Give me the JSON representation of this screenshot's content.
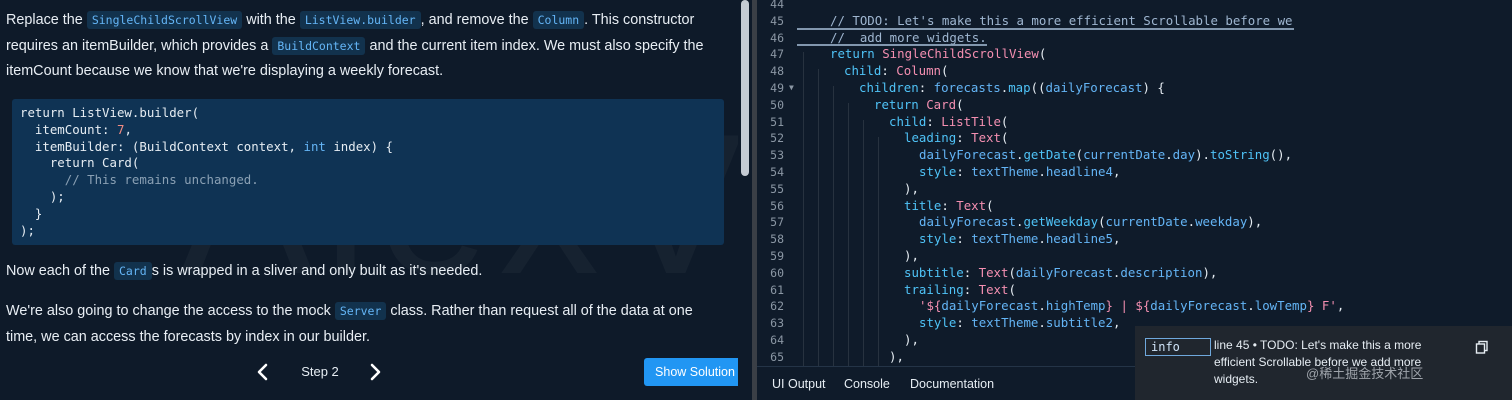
{
  "instructions": {
    "p1": {
      "a": "Replace the ",
      "code1": "SingleChildScrollView",
      "b": " with the ",
      "code2": "ListView.builder",
      "c": ", and remove the ",
      "code3": "Column",
      "d": ". This constructor requires an itemBuilder, which provides a ",
      "code4": "BuildContext",
      "e": " and the current item index. We must also specify the itemCount because we know that we're displaying a weekly forecast."
    },
    "snippet": {
      "l1a": "return ListView.builder(",
      "l2a": "  itemCount: ",
      "l2num": "7",
      "l2b": ",",
      "l3a": "  itemBuilder: (BuildContext context, ",
      "l3kw": "int",
      "l3b": " index) {",
      "l4a": "    return Card(",
      "l5cm": "      // This remains unchanged.",
      "l6a": "    );",
      "l7a": "  }",
      "l8a": ");"
    },
    "p2": {
      "a": "Now each of the ",
      "code": "Card",
      "b": "s is wrapped in a sliver and only built as it's needed."
    },
    "p3": {
      "a": "We're also going to change the access to the mock ",
      "code": "Server",
      "b": " class. Rather than request all of the data at one time, we can access the forecasts by index in our builder."
    },
    "watermark": "AlexV525"
  },
  "stepper": {
    "label": "Step 2",
    "show_solution": "Show Solution",
    "prev_icon": "chevron-left-icon",
    "next_icon": "chevron-right-icon"
  },
  "editor": {
    "line_numbers": [
      "44",
      "45",
      "46",
      "47",
      "48",
      "49",
      "50",
      "51",
      "52",
      "53",
      "54",
      "55",
      "56",
      "57",
      "58",
      "59",
      "60",
      "61",
      "62",
      "63",
      "64",
      "65"
    ],
    "lines": {
      "l45": "// TODO: Let's make this a more efficient Scrollable before we",
      "l46": "//  add more widgets.",
      "l47a": "return ",
      "l47b": "SingleChildScrollView",
      "l47c": "(",
      "l48a": "child",
      "l48b": ": ",
      "l48c": "Column",
      "l48d": "(",
      "l49a": "children",
      "l49b": ": ",
      "l49c": "forecasts",
      "l49d": ".",
      "l49e": "map",
      "l49f": "((",
      "l49g": "dailyForecast",
      "l49h": ") {",
      "l50a": "return ",
      "l50b": "Card",
      "l50c": "(",
      "l51a": "child",
      "l51b": ": ",
      "l51c": "ListTile",
      "l51d": "(",
      "l52a": "leading",
      "l52b": ": ",
      "l52c": "Text",
      "l52d": "(",
      "l53a": "dailyForecast",
      "l53b": ".",
      "l53c": "getDate",
      "l53d": "(",
      "l53e": "currentDate",
      "l53f": ".",
      "l53g": "day",
      "l53h": ").",
      "l53i": "toString",
      "l53j": "(),",
      "l54a": "style",
      "l54b": ": ",
      "l54c": "textTheme",
      "l54d": ".",
      "l54e": "headline4",
      "l54f": ",",
      "l55": "),",
      "l56a": "title",
      "l56b": ": ",
      "l56c": "Text",
      "l56d": "(",
      "l57a": "dailyForecast",
      "l57b": ".",
      "l57c": "getWeekday",
      "l57d": "(",
      "l57e": "currentDate",
      "l57f": ".",
      "l57g": "weekday",
      "l57h": "),",
      "l58a": "style",
      "l58b": ": ",
      "l58c": "textTheme",
      "l58d": ".",
      "l58e": "headline5",
      "l58f": ",",
      "l59": "),",
      "l60a": "subtitle",
      "l60b": ": ",
      "l60c": "Text",
      "l60d": "(",
      "l60e": "dailyForecast",
      "l60f": ".",
      "l60g": "description",
      "l60h": "),",
      "l61a": "trailing",
      "l61b": ": ",
      "l61c": "Text",
      "l61d": "(",
      "l62a": "'${",
      "l62b": "dailyForecast",
      "l62c": ".",
      "l62d": "highTemp",
      "l62e": "} | ${",
      "l62f": "dailyForecast",
      "l62g": ".",
      "l62h": "lowTemp",
      "l62i": "} F'",
      "l62j": ",",
      "l63a": "style",
      "l63b": ": ",
      "l63c": "textTheme",
      "l63d": ".",
      "l63e": "subtitle2",
      "l63f": ",",
      "l64": "),",
      "l65": "),"
    }
  },
  "tabs": {
    "ui_output": "UI Output",
    "console": "Console",
    "documentation": "Documentation"
  },
  "tooltip": {
    "badge": "info",
    "text": "line 45 • TODO: Let's make this a more efficient Scrollable before we add more widgets.",
    "copy_icon": "copy-icon"
  },
  "site_mark": "@稀土掘金技术社区",
  "colors": {
    "accent": "#2196f3",
    "code_bg": "#0f3354",
    "panel_bg": "#0e1a29",
    "keyword": "#4fc3f7",
    "class": "#f48fb1"
  }
}
